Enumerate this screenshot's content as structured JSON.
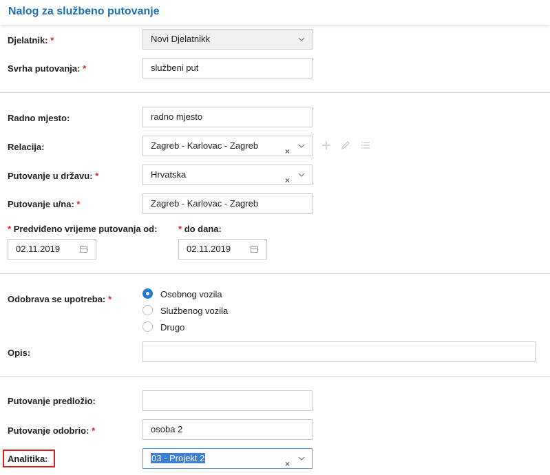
{
  "header": {
    "title": "Nalog za službeno putovanje"
  },
  "required_mark": "*",
  "fields": {
    "employee": {
      "label": "Djelatnik:",
      "value": "Novi Djelatnikk"
    },
    "purpose": {
      "label": "Svrha putovanja:",
      "value": "službeni put"
    },
    "workplace": {
      "label": "Radno mjesto:",
      "value": "radno mjesto"
    },
    "relation": {
      "label": "Relacija:",
      "value": "Zagreb - Karlovac - Zagreb"
    },
    "country": {
      "label": "Putovanje u državu:",
      "value": "Hrvatska"
    },
    "destination": {
      "label": "Putovanje u/na:",
      "value": "Zagreb - Karlovac - Zagreb"
    },
    "date_from": {
      "label": "Predviđeno vrijeme putovanja od:",
      "value": "02.11.2019"
    },
    "date_to": {
      "label": "do dana:",
      "value": "02.11.2019"
    },
    "vehicle": {
      "label": "Odobrava se upotreba:",
      "options": [
        "Osobnog vozila",
        "Službenog vozila",
        "Drugo"
      ],
      "selected_index": 0
    },
    "description": {
      "label": "Opis:",
      "value": ""
    },
    "proposed_by": {
      "label": "Putovanje predložio:",
      "value": ""
    },
    "approved_by": {
      "label": "Putovanje odobrio:",
      "value": "osoba 2"
    },
    "analytics": {
      "label": "Analitika:",
      "value": "03 - Projekt 2"
    }
  },
  "icons": {
    "clear": "×",
    "dropdown": "chevron-down-icon",
    "calendar": "calendar-icon",
    "add": "plus-icon",
    "edit": "pencil-icon",
    "list": "list-icon"
  },
  "colors": {
    "title": "#1f6fb2",
    "required": "#d22222",
    "radio_selected": "#1f7ccf",
    "highlight": "#d21f1f"
  }
}
